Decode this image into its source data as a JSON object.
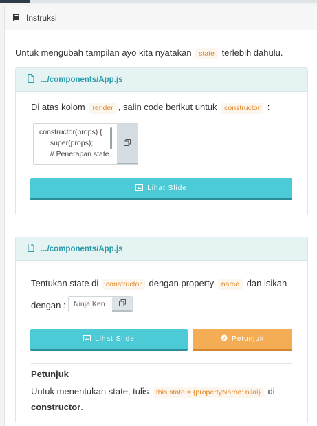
{
  "panel": {
    "title": "Instruksi"
  },
  "intro": {
    "before": "Untuk mengubah tampilan ayo kita nyatakan",
    "code": "state",
    "after": "terlebih dahulu."
  },
  "step1": {
    "file": ".../components/App.js",
    "text_before": "Di atas kolom",
    "code1": "render",
    "text_mid": ", salin code berikut untuk",
    "code2": "constructor",
    "text_after": ":",
    "codebox_lines": [
      "constructor(props) {",
      "  super(props);",
      "  // Penerapan state"
    ],
    "button_label": "Lihat Slide"
  },
  "step2": {
    "file": ".../components/App.js",
    "text_before": "Tentukan state di",
    "code1": "constructor",
    "text_mid": "dengan property",
    "code2": "name",
    "text_after": "dan isikan",
    "line2": "dengan :",
    "input_value": "Ninja Ken",
    "slide_button": "Lihat Slide",
    "hint_button": "Petunjuk",
    "hint_title": "Petunjuk",
    "hint_before": "Untuk menentukan state, tulis",
    "hint_code": "this.state = {propertyName: nilai}",
    "hint_mid": "di",
    "hint_strong": "constructor",
    "hint_end": "."
  },
  "colors": {
    "accent": "#2a9bab",
    "button_teal": "#4ccad6",
    "button_orange": "#f5ad55",
    "code": "#e0892a"
  },
  "icons": [
    "book-icon",
    "file-icon",
    "copy-icon",
    "image-icon",
    "question-circle-icon"
  ]
}
